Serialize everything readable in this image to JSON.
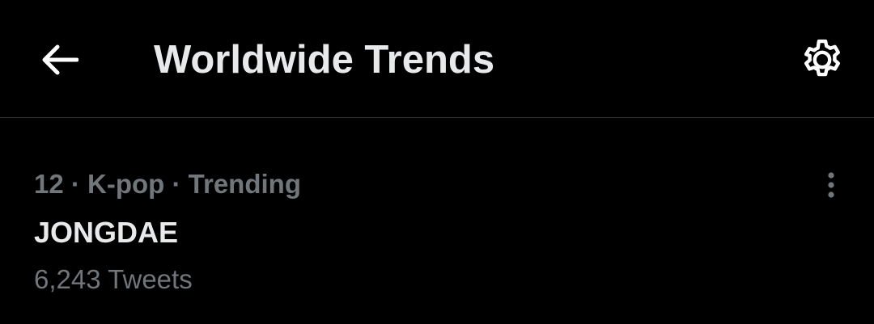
{
  "header": {
    "title": "Worldwide Trends",
    "back_icon": "arrow-left-icon",
    "settings_icon": "gear-icon"
  },
  "trend": {
    "rank": "12",
    "category": "K-pop",
    "status": "Trending",
    "meta": "12 · K-pop · Trending",
    "name": "JONGDAE",
    "tweet_count": "6,243 Tweets",
    "more_icon": "more-vertical-icon"
  },
  "colors": {
    "background": "#000000",
    "primary_text": "#e7e9ea",
    "secondary_text": "#71767b",
    "divider": "#2f3336"
  }
}
